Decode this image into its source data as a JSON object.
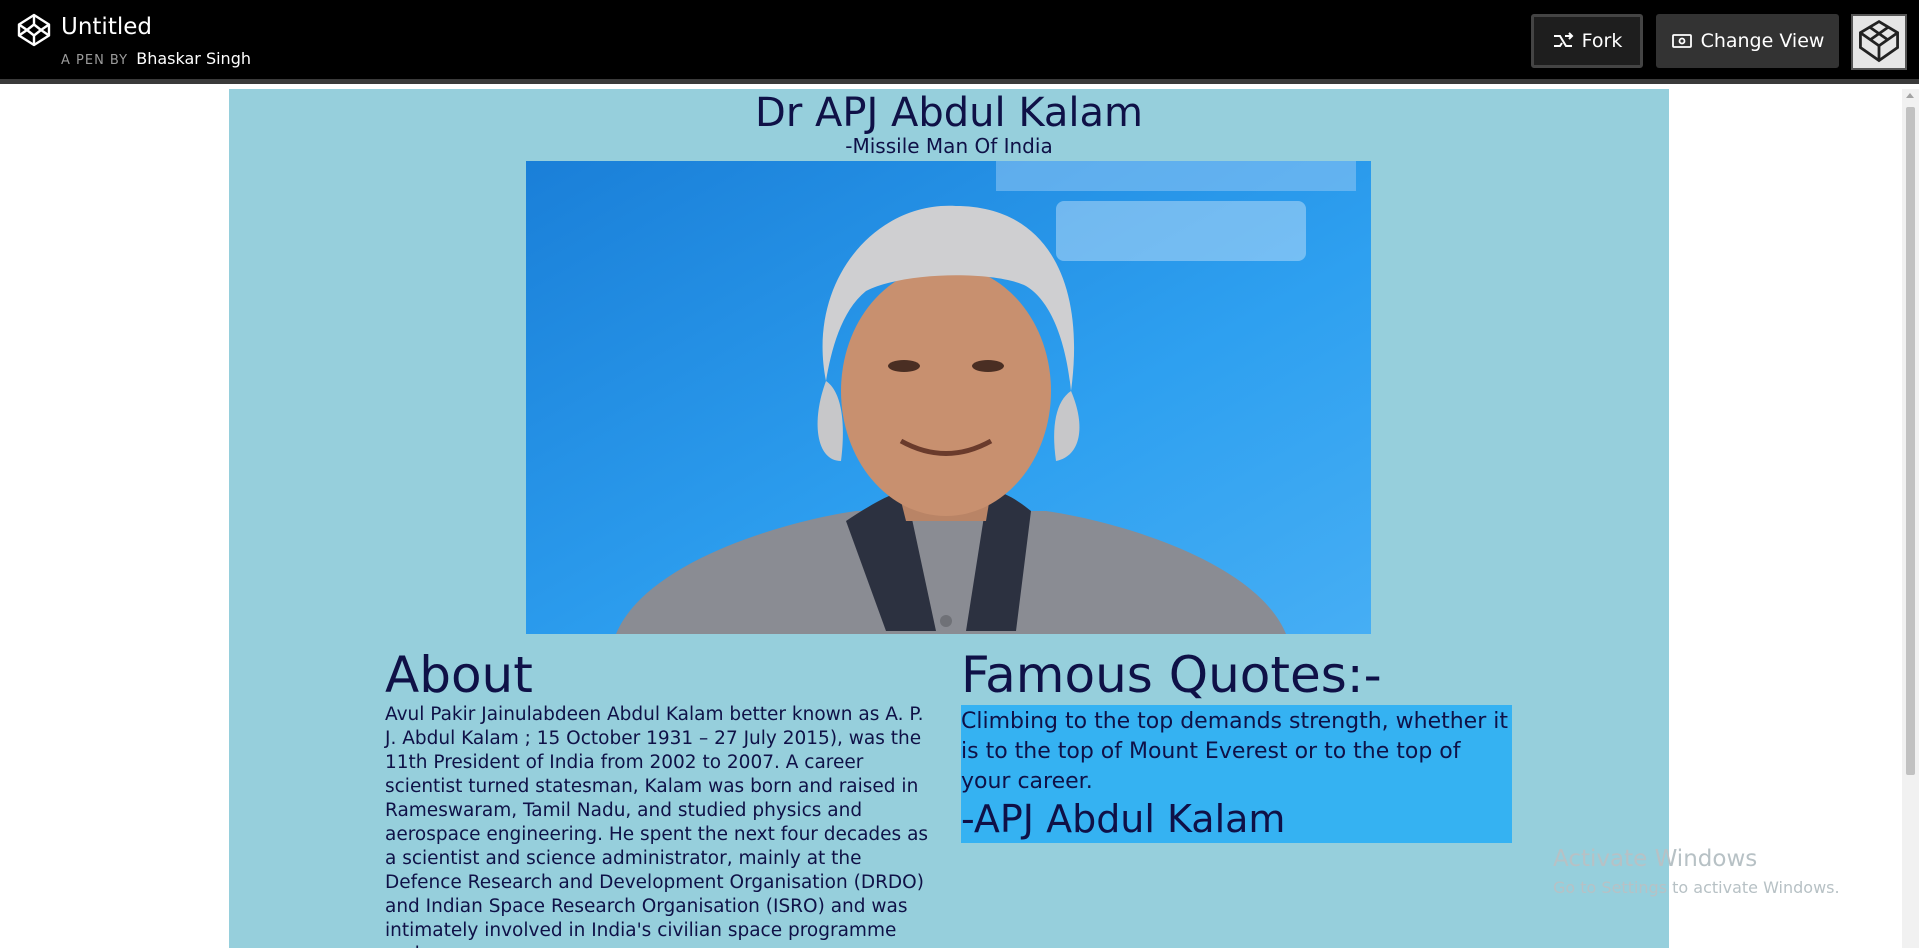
{
  "header": {
    "title": "Untitled",
    "by_label": "A PEN BY",
    "author": "Bhaskar Singh",
    "fork_label": "Fork",
    "change_view_label": "Change View"
  },
  "page": {
    "title": "Dr APJ Abdul Kalam",
    "subtitle": "-Missile Man Of India",
    "about_heading": "About",
    "about_text": "Avul Pakir Jainulabdeen Abdul Kalam better known as A. P. J. Abdul Kalam ; 15 October 1931 – 27 July 2015), was the 11th President of India from 2002 to 2007. A career scientist turned statesman, Kalam was born and raised in Rameswaram, Tamil Nadu, and studied physics and aerospace engineering. He spent the next four decades as a scientist and science administrator, mainly at the Defence Research and Development Organisation (DRDO) and Indian Space Research Organisation (ISRO) and was intimately involved in India's civilian space programme and",
    "quotes_heading": "Famous Quotes:-",
    "quote_text": "Climbing to the top demands strength, whether it is to the top of Mount Everest or to the top of your career.",
    "quote_author": "-APJ Abdul Kalam"
  },
  "watermark": {
    "title": "Activate Windows",
    "subtitle": "Go to Settings to activate Windows."
  },
  "colors": {
    "topbar": "#000000",
    "page_background": "#96cfdc",
    "text": "#0f1147",
    "quote_highlight": "#35b2f2",
    "portrait_background": "#2b9df0"
  },
  "icons": [
    "codepen-logo-icon",
    "fork-icon",
    "change-view-icon",
    "avatar"
  ]
}
